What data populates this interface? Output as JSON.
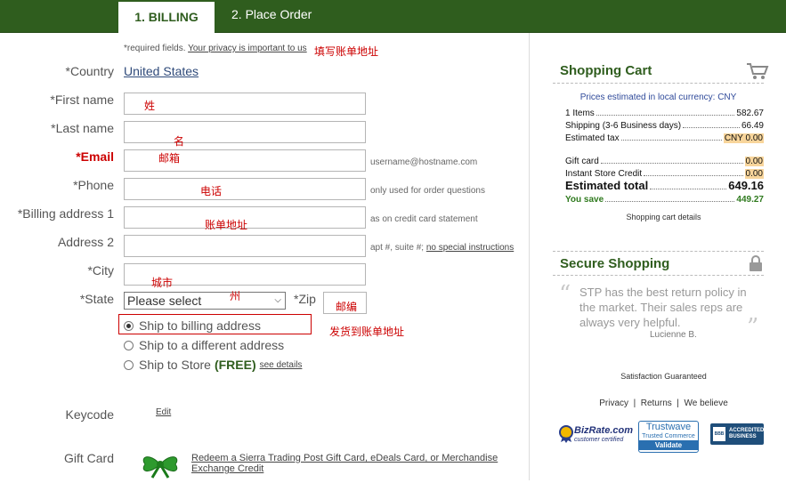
{
  "tabs": {
    "billing": "1. BILLING",
    "order": "2. Place Order"
  },
  "form": {
    "required_note": "*required fields.",
    "privacy_link": "Your privacy is important to us",
    "country_label": "*Country",
    "country_value": "United States",
    "first_name_label": "*First name",
    "last_name_label": "*Last name",
    "email_label": "*Email",
    "email_hint": "username@hostname.com",
    "phone_label": "*Phone",
    "phone_hint": "only used for order questions",
    "billing1_label": "*Billing address 1",
    "billing1_hint": "as on credit card statement",
    "address2_label": "Address 2",
    "address2_hint": "apt #, suite #;",
    "address2_link": "no special instructions",
    "city_label": "*City",
    "state_label": "*State",
    "state_value": "Please select",
    "zip_label": "*Zip",
    "ship_billing": "Ship to billing address",
    "ship_different": "Ship to a different address",
    "ship_store": "Ship to Store",
    "ship_store_free": "(FREE)",
    "see_details": "see details",
    "keycode_label": "Keycode",
    "keycode_edit": "Edit",
    "giftcard_label": "Gift Card",
    "giftcard_link": "Redeem a Sierra Trading Post Gift Card, eDeals Card, or Merchandise Exchange Credit"
  },
  "annotations": {
    "billing_address": "填写账单地址",
    "first_name": "姓",
    "last_name": "名",
    "email": "邮箱",
    "phone": "电话",
    "billing1": "账单地址",
    "city": "城市",
    "state": "州",
    "zip": "邮编",
    "ship_billing": "发货到账单地址"
  },
  "cart": {
    "title": "Shopping Cart",
    "currency_note": "Prices estimated in local currency: CNY",
    "items_label": "1 Items",
    "items_value": "582.67",
    "shipping_label": "Shipping (3-6 Business days)",
    "shipping_value": "66.49",
    "tax_label": "Estimated tax",
    "tax_value": "CNY 0.00",
    "giftcard_label": "Gift card",
    "giftcard_value": "0.00",
    "storecredit_label": "Instant Store Credit",
    "storecredit_value": "0.00",
    "total_label": "Estimated total",
    "total_value": "649.16",
    "save_label": "You save",
    "save_value": "449.27",
    "details_link": "Shopping cart details"
  },
  "secure": {
    "title": "Secure Shopping",
    "quote": "STP has the best return policy in the market. Their sales reps are always very helpful.",
    "author": "Lucienne B.",
    "guarantee": "Satisfaction Guaranteed",
    "links": [
      "Privacy",
      "Returns",
      "We believe"
    ],
    "bizrate_name": "BizRate.com",
    "bizrate_sub": "customer certified",
    "trustwave_name": "Trustwave",
    "trustwave_sub": "Trusted Commerce",
    "trustwave_validate": "Validate",
    "bbb_text1": "ACCREDITED",
    "bbb_text2": "BUSINESS",
    "bbb_mark": "BBB"
  },
  "colors": {
    "brand_green": "#2f5d1e",
    "annotation_red": "#cc0000",
    "highlight": "#f8d59b"
  }
}
